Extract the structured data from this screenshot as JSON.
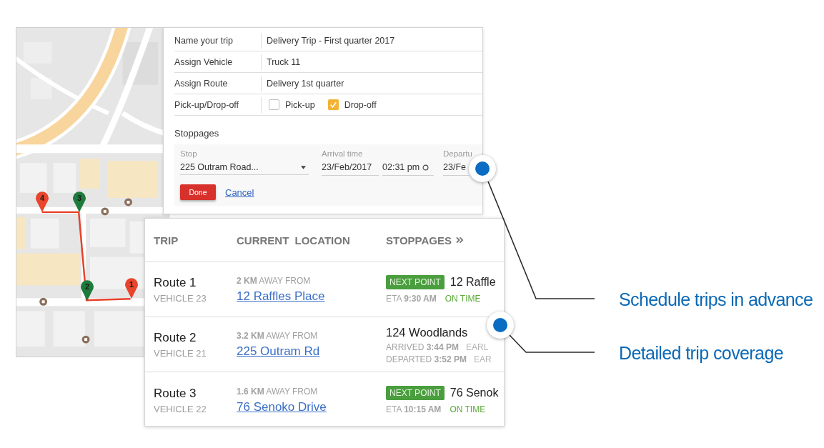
{
  "map": {
    "pins": [
      {
        "label": "1",
        "color": "#e8452c"
      },
      {
        "label": "2",
        "color": "#1e7b3c"
      },
      {
        "label": "3",
        "color": "#1e7b3c"
      },
      {
        "label": "4",
        "color": "#e8452c"
      }
    ]
  },
  "trip_form": {
    "fields": [
      {
        "label": "Name your trip",
        "value": "Delivery Trip - First quarter 2017"
      },
      {
        "label": "Assign Vehicle",
        "value": "Truck 11"
      },
      {
        "label": "Assign Route",
        "value": "Delivery 1st quarter"
      }
    ],
    "pickup_dropoff": {
      "label": "Pick-up/Drop-off",
      "options": [
        {
          "label": "Pick-up",
          "checked": false
        },
        {
          "label": "Drop-off",
          "checked": true
        }
      ]
    },
    "stoppages": {
      "title": "Stoppages",
      "stop": {
        "label": "Stop",
        "value": "225 Outram Road..."
      },
      "arrival": {
        "label": "Arrival time",
        "date": "23/Feb/2017",
        "time": "02:31 pm"
      },
      "departure": {
        "label": "Departu",
        "date": "23/Fe"
      }
    },
    "done_button": "Done",
    "cancel_link": "Cancel"
  },
  "trips_table": {
    "columns": [
      "TRIP",
      "CURRENT LOCATION",
      "STOPPAGES"
    ],
    "rows": [
      {
        "kind": "next_point",
        "route": "Route 1",
        "vehicle": "VEHICLE 23",
        "distance": "**2 KM** AWAY FROM",
        "location": "12 Raffles Place",
        "badge": "NEXT POINT",
        "stop": "12 Raffle",
        "eta": "ETA **9:30 AM**",
        "status": "ON TIME"
      },
      {
        "kind": "visited",
        "route": "Route 2",
        "vehicle": "VEHICLE 21",
        "distance": "**3.2 KM** AWAY FROM",
        "location": "225 Outram Rd",
        "stop": "124 Woodlands",
        "times": [
          {
            "text": "ARRIVED **3:44 PM**",
            "status": "EARL"
          },
          {
            "text": "DEPARTED **3:52 PM**",
            "status": "EAR"
          }
        ]
      },
      {
        "kind": "next_point",
        "route": "Route 3",
        "vehicle": "VEHICLE 22",
        "distance": "**1.6 KM** AWAY FROM",
        "location": "76 Senoko Drive",
        "badge": "NEXT POINT",
        "stop": "76 Senok",
        "eta": "ETA **10:15 AM**",
        "status": "ON TIME"
      }
    ]
  },
  "callouts": [
    "Schedule trips in advance",
    "Detailed trip coverage"
  ]
}
